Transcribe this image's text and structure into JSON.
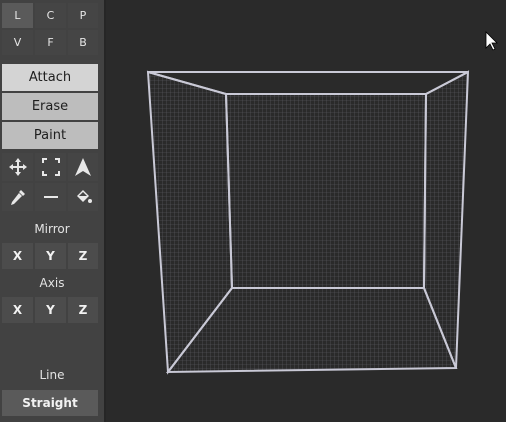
{
  "modes": [
    "L",
    "C",
    "P",
    "V",
    "F",
    "B"
  ],
  "actions": [
    "Attach",
    "Erase",
    "Paint"
  ],
  "tools": [
    {
      "name": "move-icon"
    },
    {
      "name": "select-box-icon"
    },
    {
      "name": "arrow-pointer-icon"
    },
    {
      "name": "eyedropper-icon"
    },
    {
      "name": "line-icon"
    },
    {
      "name": "fill-bucket-icon"
    }
  ],
  "mirror": {
    "label": "Mirror",
    "buttons": [
      "X",
      "Y",
      "Z"
    ]
  },
  "axis": {
    "label": "Axis",
    "buttons": [
      "X",
      "Y",
      "Z"
    ]
  },
  "line": {
    "label": "Line",
    "value": "Straight"
  },
  "colors": {
    "sidebar": "#424242",
    "viewport": "#2a2a2a",
    "grid": "#5e5e66",
    "edge": "#c9c9d6"
  }
}
